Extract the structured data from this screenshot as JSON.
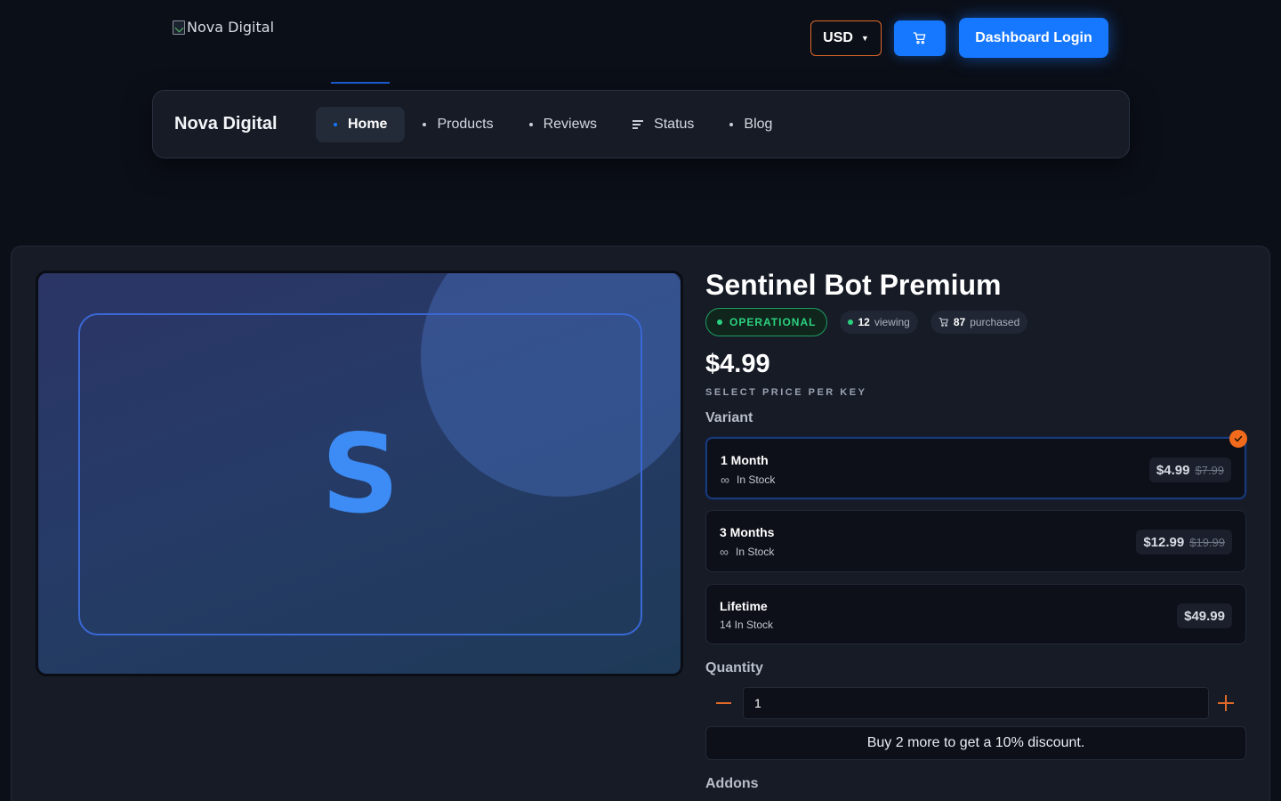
{
  "header": {
    "logo_alt": "Nova Digital",
    "currency": "USD",
    "login_label": "Dashboard Login"
  },
  "nav": {
    "brand": "Nova Digital",
    "items": [
      {
        "label": "Home",
        "active": true
      },
      {
        "label": "Products"
      },
      {
        "label": "Reviews"
      },
      {
        "label": "Status"
      },
      {
        "label": "Blog"
      }
    ]
  },
  "product": {
    "image_letter": "S",
    "title": "Sentinel Bot Premium",
    "status": "OPERATIONAL",
    "viewing_count": "12",
    "viewing_label": "viewing",
    "purchased_count": "87",
    "purchased_label": "purchased",
    "price": "$4.99",
    "price_sub": "SELECT PRICE PER KEY",
    "variant_label": "Variant",
    "variants": [
      {
        "name": "1 Month",
        "stock": "In Stock",
        "price": "$4.99",
        "old_price": "$7.99",
        "selected": true
      },
      {
        "name": "3 Months",
        "stock": "In Stock",
        "price": "$12.99",
        "old_price": "$19.99"
      },
      {
        "name": "Lifetime",
        "stock": "14 In Stock",
        "price": "$49.99"
      }
    ],
    "quantity_label": "Quantity",
    "quantity_value": "1",
    "discount_text": "Buy 2 more to get a 10% discount.",
    "addons_label": "Addons"
  },
  "colors": {
    "accent": "#1677ff",
    "orange": "#e0692a",
    "success": "#2bd17f"
  }
}
